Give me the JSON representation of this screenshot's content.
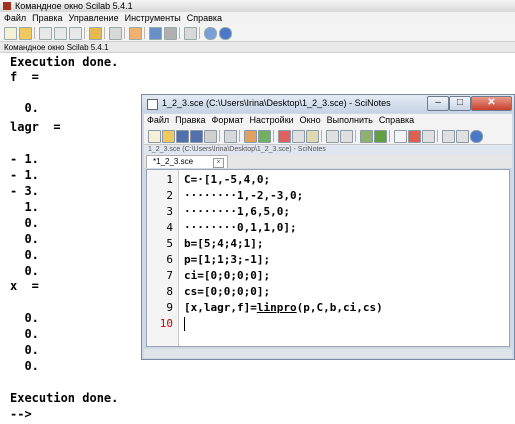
{
  "console_window": {
    "title": "Командное окно Scilab 5.4.1",
    "menu": [
      "Файл",
      "Правка",
      "Управление",
      "Инструменты",
      "Справка"
    ],
    "tab_label": "Командное окно Scilab 5.4.1",
    "lines": [
      "Execution done.",
      "f  =",
      "",
      "  0.",
      "lagr  =",
      "",
      "- 1.",
      "- 1.",
      "- 3.",
      "  1.",
      "  0.",
      "  0.",
      "  0.",
      "  0.",
      "x  =",
      "",
      "  0.",
      "  0.",
      "  0.",
      "  0.",
      "",
      "Execution done.",
      "-->"
    ]
  },
  "scinotes": {
    "title": "1_2_3.sce (C:\\Users\\Irina\\Desktop\\1_2_3.sce) - SciNotes",
    "menu": [
      "Файл",
      "Правка",
      "Формат",
      "Настройки",
      "Окно",
      "Выполнить",
      "Справка"
    ],
    "path_label": "1_2_3.sce (C:\\Users\\Irina\\Desktop\\1_2_3.sce) - SciNotes",
    "tab_label": "*1_2_3.sce",
    "code_lines": [
      {
        "n": "1",
        "text": "C=·[1,-5,4,0;"
      },
      {
        "n": "2",
        "text": "········1,-2,-3,0;"
      },
      {
        "n": "3",
        "text": "········1,6,5,0;"
      },
      {
        "n": "4",
        "text": "········0,1,1,0];"
      },
      {
        "n": "5",
        "text": "b=[5;4;4;1];"
      },
      {
        "n": "6",
        "text": "p=[1;1;3;-1];"
      },
      {
        "n": "7",
        "text": "ci=[0;0;0;0];"
      },
      {
        "n": "8",
        "text": "cs=[0;0;0;0];"
      },
      {
        "n": "9",
        "pre": "[x,lagr,f]=",
        "fn": "linpro",
        "post": "(p,C,b,ci,cs)"
      },
      {
        "n": "10",
        "text": ""
      }
    ]
  },
  "colors": {
    "active_line_number": "#d00000",
    "window_frame": "#cfd8e4"
  }
}
